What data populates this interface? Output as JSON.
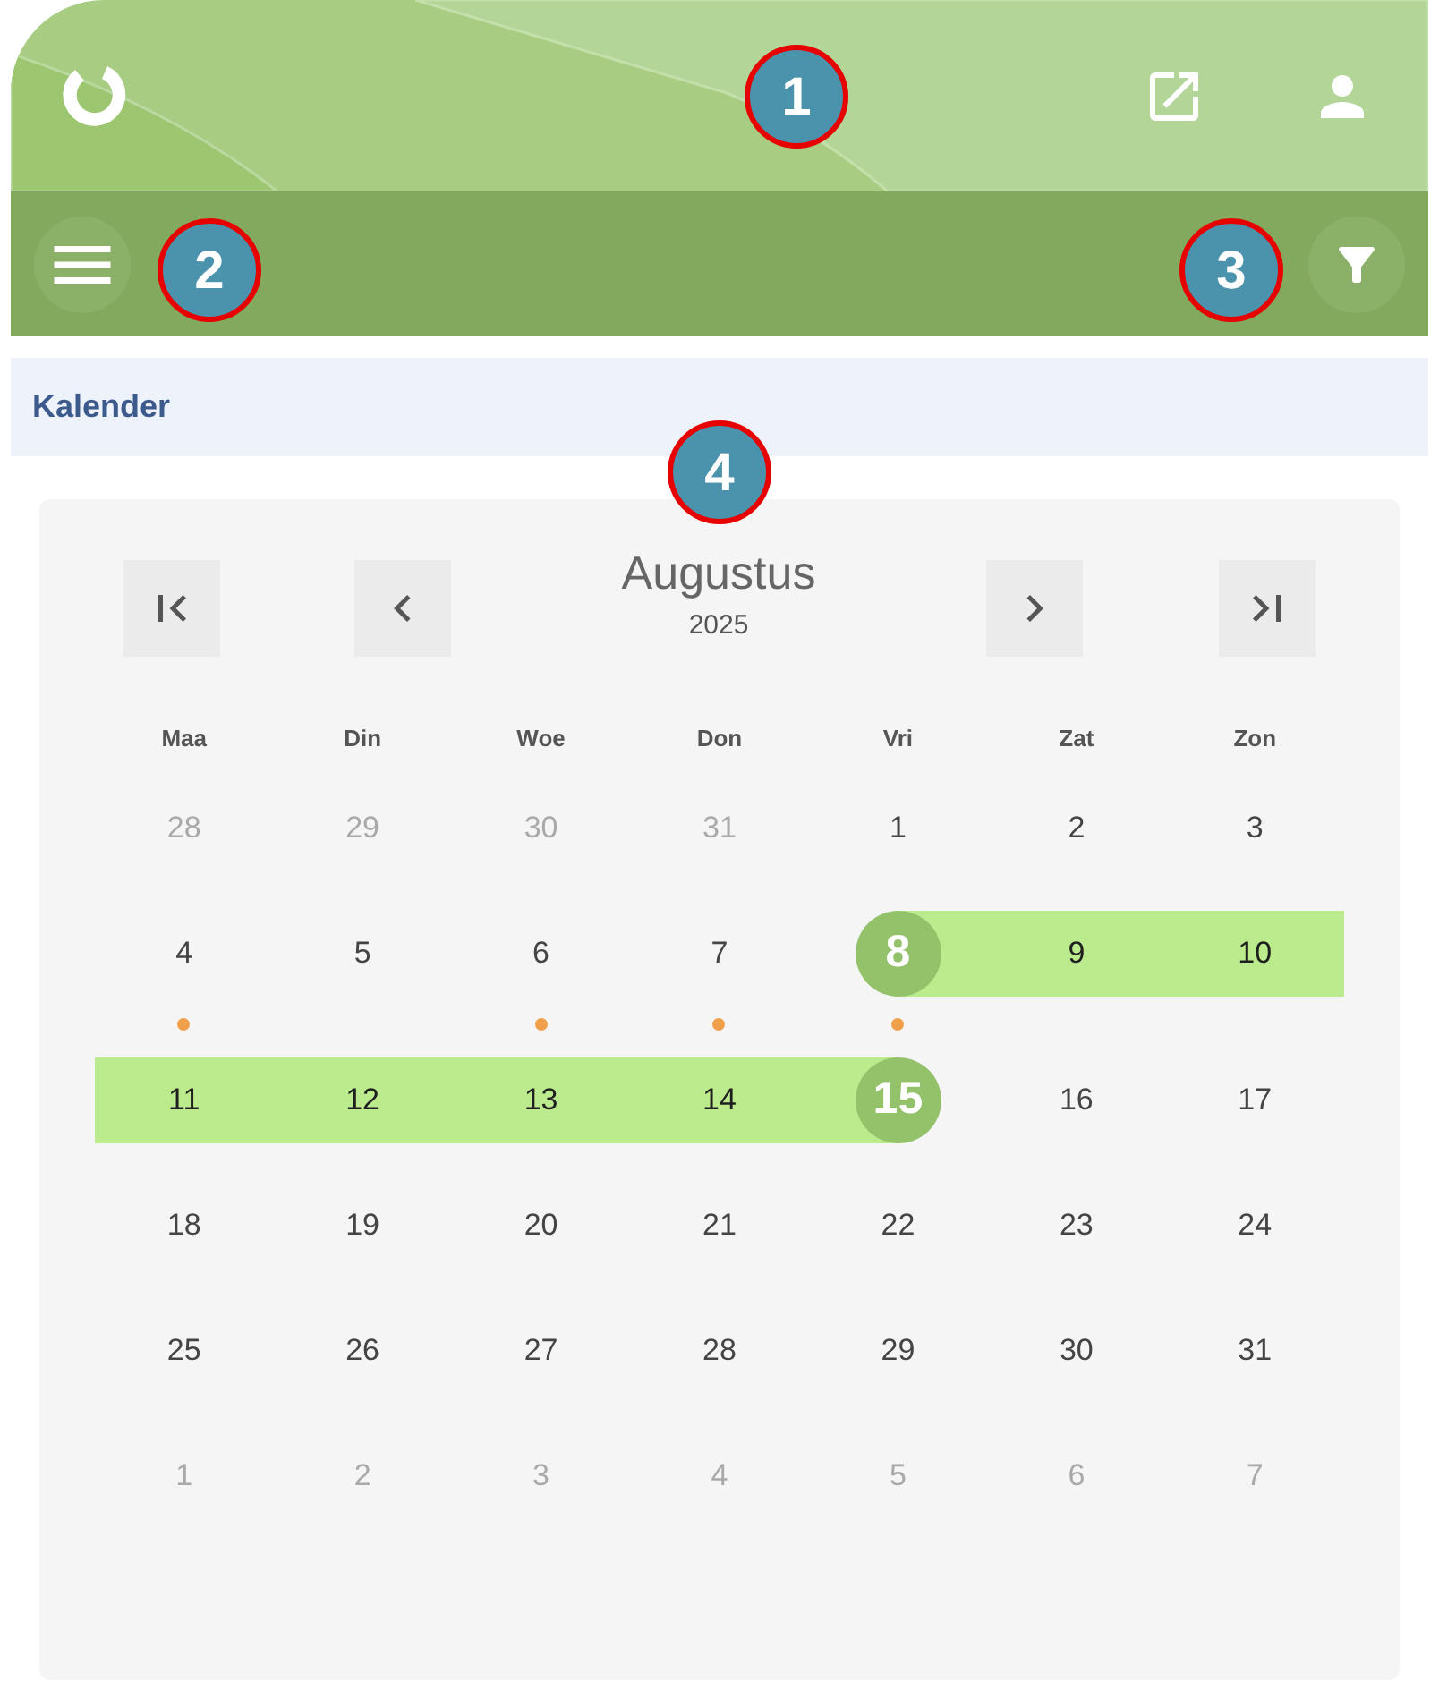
{
  "page_title": {
    "title": "Kalender"
  },
  "calendar": {
    "month": "Augustus",
    "year": "2025",
    "weekdays": [
      "Maa",
      "Din",
      "Woe",
      "Don",
      "Vri",
      "Zat",
      "Zon"
    ],
    "weeks": [
      {
        "days": [
          {
            "label": "28",
            "kind": "other_month",
            "event": false
          },
          {
            "label": "29",
            "kind": "other_month",
            "event": false
          },
          {
            "label": "30",
            "kind": "other_month",
            "event": false
          },
          {
            "label": "31",
            "kind": "other_month",
            "event": false
          },
          {
            "label": "1",
            "kind": "day",
            "event": false
          },
          {
            "label": "2",
            "kind": "day",
            "event": false
          },
          {
            "label": "3",
            "kind": "day",
            "event": false
          }
        ]
      },
      {
        "days": [
          {
            "label": "4",
            "kind": "day",
            "event": true
          },
          {
            "label": "5",
            "kind": "day",
            "event": false
          },
          {
            "label": "6",
            "kind": "day",
            "event": true
          },
          {
            "label": "7",
            "kind": "day",
            "event": true
          },
          {
            "label": "8",
            "kind": "range_start",
            "event": true
          },
          {
            "label": "9",
            "kind": "in_range",
            "event": false
          },
          {
            "label": "10",
            "kind": "in_range",
            "event": false
          }
        ]
      },
      {
        "days": [
          {
            "label": "11",
            "kind": "in_range",
            "event": false
          },
          {
            "label": "12",
            "kind": "in_range",
            "event": false
          },
          {
            "label": "13",
            "kind": "in_range",
            "event": false
          },
          {
            "label": "14",
            "kind": "in_range",
            "event": false
          },
          {
            "label": "15",
            "kind": "range_end",
            "event": false
          },
          {
            "label": "16",
            "kind": "day",
            "event": false
          },
          {
            "label": "17",
            "kind": "day",
            "event": false
          }
        ]
      },
      {
        "days": [
          {
            "label": "18",
            "kind": "day",
            "event": false
          },
          {
            "label": "19",
            "kind": "day",
            "event": false
          },
          {
            "label": "20",
            "kind": "day",
            "event": false
          },
          {
            "label": "21",
            "kind": "day",
            "event": false
          },
          {
            "label": "22",
            "kind": "day",
            "event": false
          },
          {
            "label": "23",
            "kind": "day",
            "event": false
          },
          {
            "label": "24",
            "kind": "day",
            "event": false
          }
        ]
      },
      {
        "days": [
          {
            "label": "25",
            "kind": "day",
            "event": false
          },
          {
            "label": "26",
            "kind": "day",
            "event": false
          },
          {
            "label": "27",
            "kind": "day",
            "event": false
          },
          {
            "label": "28",
            "kind": "day",
            "event": false
          },
          {
            "label": "29",
            "kind": "day",
            "event": false
          },
          {
            "label": "30",
            "kind": "day",
            "event": false
          },
          {
            "label": "31",
            "kind": "day",
            "event": false
          }
        ]
      },
      {
        "days": [
          {
            "label": "1",
            "kind": "other_month",
            "event": false
          },
          {
            "label": "2",
            "kind": "other_month",
            "event": false
          },
          {
            "label": "3",
            "kind": "other_month",
            "event": false
          },
          {
            "label": "4",
            "kind": "other_month",
            "event": false
          },
          {
            "label": "5",
            "kind": "other_month",
            "event": false
          },
          {
            "label": "6",
            "kind": "other_month",
            "event": false
          },
          {
            "label": "7",
            "kind": "other_month",
            "event": false
          }
        ]
      }
    ]
  },
  "callouts": [
    {
      "label": "1"
    },
    {
      "label": "2"
    },
    {
      "label": "3"
    },
    {
      "label": "4"
    }
  ]
}
